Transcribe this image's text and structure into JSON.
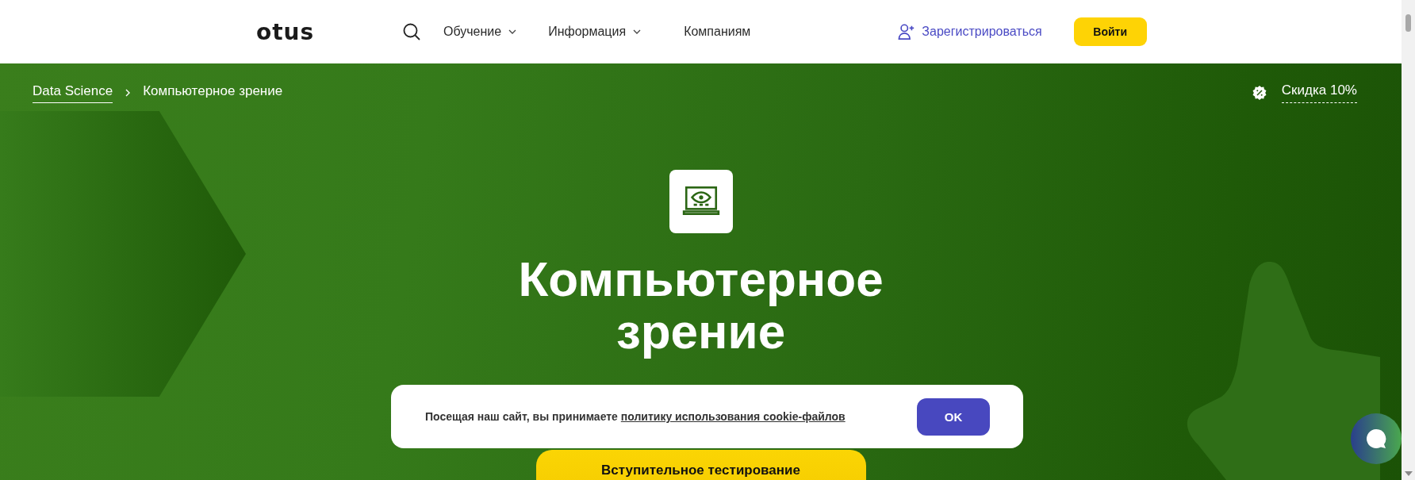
{
  "header": {
    "logo": "otus",
    "nav": [
      {
        "label": "Обучение",
        "dropdown": true
      },
      {
        "label": "Информация",
        "dropdown": true
      },
      {
        "label": "Компаниям",
        "dropdown": false
      }
    ],
    "register": "Зарегистрироваться",
    "login": "Войти"
  },
  "breadcrumbs": [
    {
      "label": "Data Science",
      "link": true
    },
    {
      "label": "Компьютерное зрение",
      "link": false
    }
  ],
  "discount": "Скидка 10%",
  "hero": {
    "title": "Компьютерное зрение",
    "button": "Вступительное тестирование"
  },
  "cookie": {
    "text": "Посещая наш сайт, вы принимаете ",
    "link": "политику использования cookie-файлов",
    "button": "OK"
  }
}
